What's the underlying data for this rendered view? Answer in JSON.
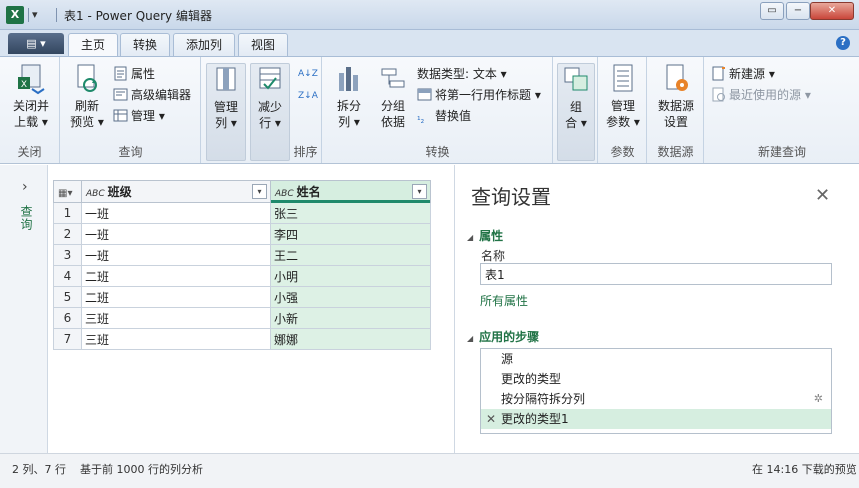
{
  "window": {
    "title": "表1 - Power Query 编辑器",
    "quick_access": "▾"
  },
  "tabs": {
    "file": "▤ ▾",
    "items": [
      "主页",
      "转换",
      "添加列",
      "视图"
    ],
    "active": "主页"
  },
  "ribbon": {
    "close": {
      "button": "关闭并\n上载",
      "b1": "关闭并",
      "b2": "上载 ▾",
      "group": "关闭"
    },
    "query": {
      "refresh1": "刷新",
      "refresh2": "预览 ▾",
      "properties": "属性",
      "advanced_editor": "高级编辑器",
      "manage": "管理 ▾",
      "group": "查询"
    },
    "manage_cols": {
      "l1": "管理",
      "l2": "列 ▾"
    },
    "reduce_rows": {
      "l1": "减少",
      "l2": "行 ▾"
    },
    "sort": {
      "group": "排序",
      "asc": "A↓Z",
      "desc": "Z↓A"
    },
    "transform": {
      "split1": "拆分",
      "split2": "列 ▾",
      "group1": "分组",
      "group2": "依据",
      "data_type": "数据类型: 文本 ▾",
      "first_row": "将第一行用作标题 ▾",
      "replace": "替换值",
      "group": "转换"
    },
    "combine": {
      "l1": "组",
      "l2": "合 ▾"
    },
    "params": {
      "l1": "管理",
      "l2": "参数 ▾",
      "group": "参数"
    },
    "datasource": {
      "l1": "数据源",
      "l2": "设置",
      "group": "数据源"
    },
    "newquery": {
      "new_source": "新建源 ▾",
      "recent": "最近使用的源 ▾",
      "group": "新建查询"
    }
  },
  "leftnav": {
    "label": "查询"
  },
  "grid": {
    "columns": [
      {
        "type": "ABC",
        "name": "班级"
      },
      {
        "type": "ABC",
        "name": "姓名"
      }
    ],
    "rows": [
      [
        "1",
        "一班",
        "张三"
      ],
      [
        "2",
        "一班",
        "李四"
      ],
      [
        "3",
        "一班",
        "王二"
      ],
      [
        "4",
        "二班",
        "小明"
      ],
      [
        "5",
        "二班",
        "小强"
      ],
      [
        "6",
        "三班",
        "小新"
      ],
      [
        "7",
        "三班",
        "娜娜"
      ]
    ]
  },
  "settings": {
    "title": "查询设置",
    "properties_header": "属性",
    "name_label": "名称",
    "name_value": "表1",
    "all_properties": "所有属性",
    "steps_header": "应用的步骤",
    "steps": [
      "源",
      "更改的类型",
      "按分隔符拆分列",
      "更改的类型1"
    ]
  },
  "status": {
    "left": "2 列、7 行",
    "middle": "基于前 1000 行的列分析",
    "right": "在 14:16 下载的预览"
  },
  "colors": {
    "accent": "#217346",
    "selected_col": "#d6eee0"
  }
}
